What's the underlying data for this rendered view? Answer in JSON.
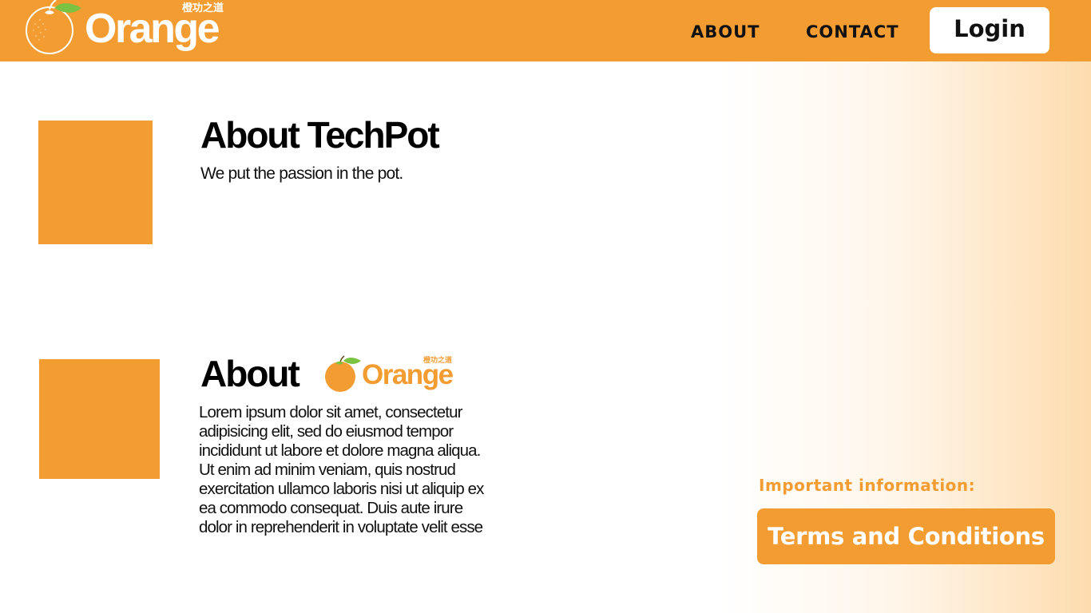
{
  "header": {
    "logo": {
      "word": "Orange",
      "tagline_cn": "橙功之道",
      "icon": "orange-fruit-icon"
    },
    "nav": {
      "about_label": "ABOUT",
      "contact_label": "CONTACT",
      "login_label": "Login"
    }
  },
  "sections": {
    "techpot": {
      "title": "About TechPot",
      "tagline": "We put the passion in the pot."
    },
    "orange": {
      "title": "About",
      "logo_word": "Orange",
      "logo_cn": "橙功之道",
      "body": "Lorem ipsum dolor sit amet, consectetur\nadipisicing elit, sed do eiusmod tempor\nincididunt ut labore et dolore magna aliqua.\nUt enim ad minim veniam, quis nostrud\nexercitation ullamco laboris nisi ut aliquip ex\nea commodo consequat. Duis aute irure\ndolor in reprehenderit in voluptate velit esse"
    }
  },
  "footer_info": {
    "heading": "Important information:",
    "terms_label": "Terms and Conditions"
  },
  "colors": {
    "brand_orange": "#f29c31",
    "leaf_green": "#7cc242",
    "white": "#ffffff",
    "text_dark": "#111111"
  }
}
